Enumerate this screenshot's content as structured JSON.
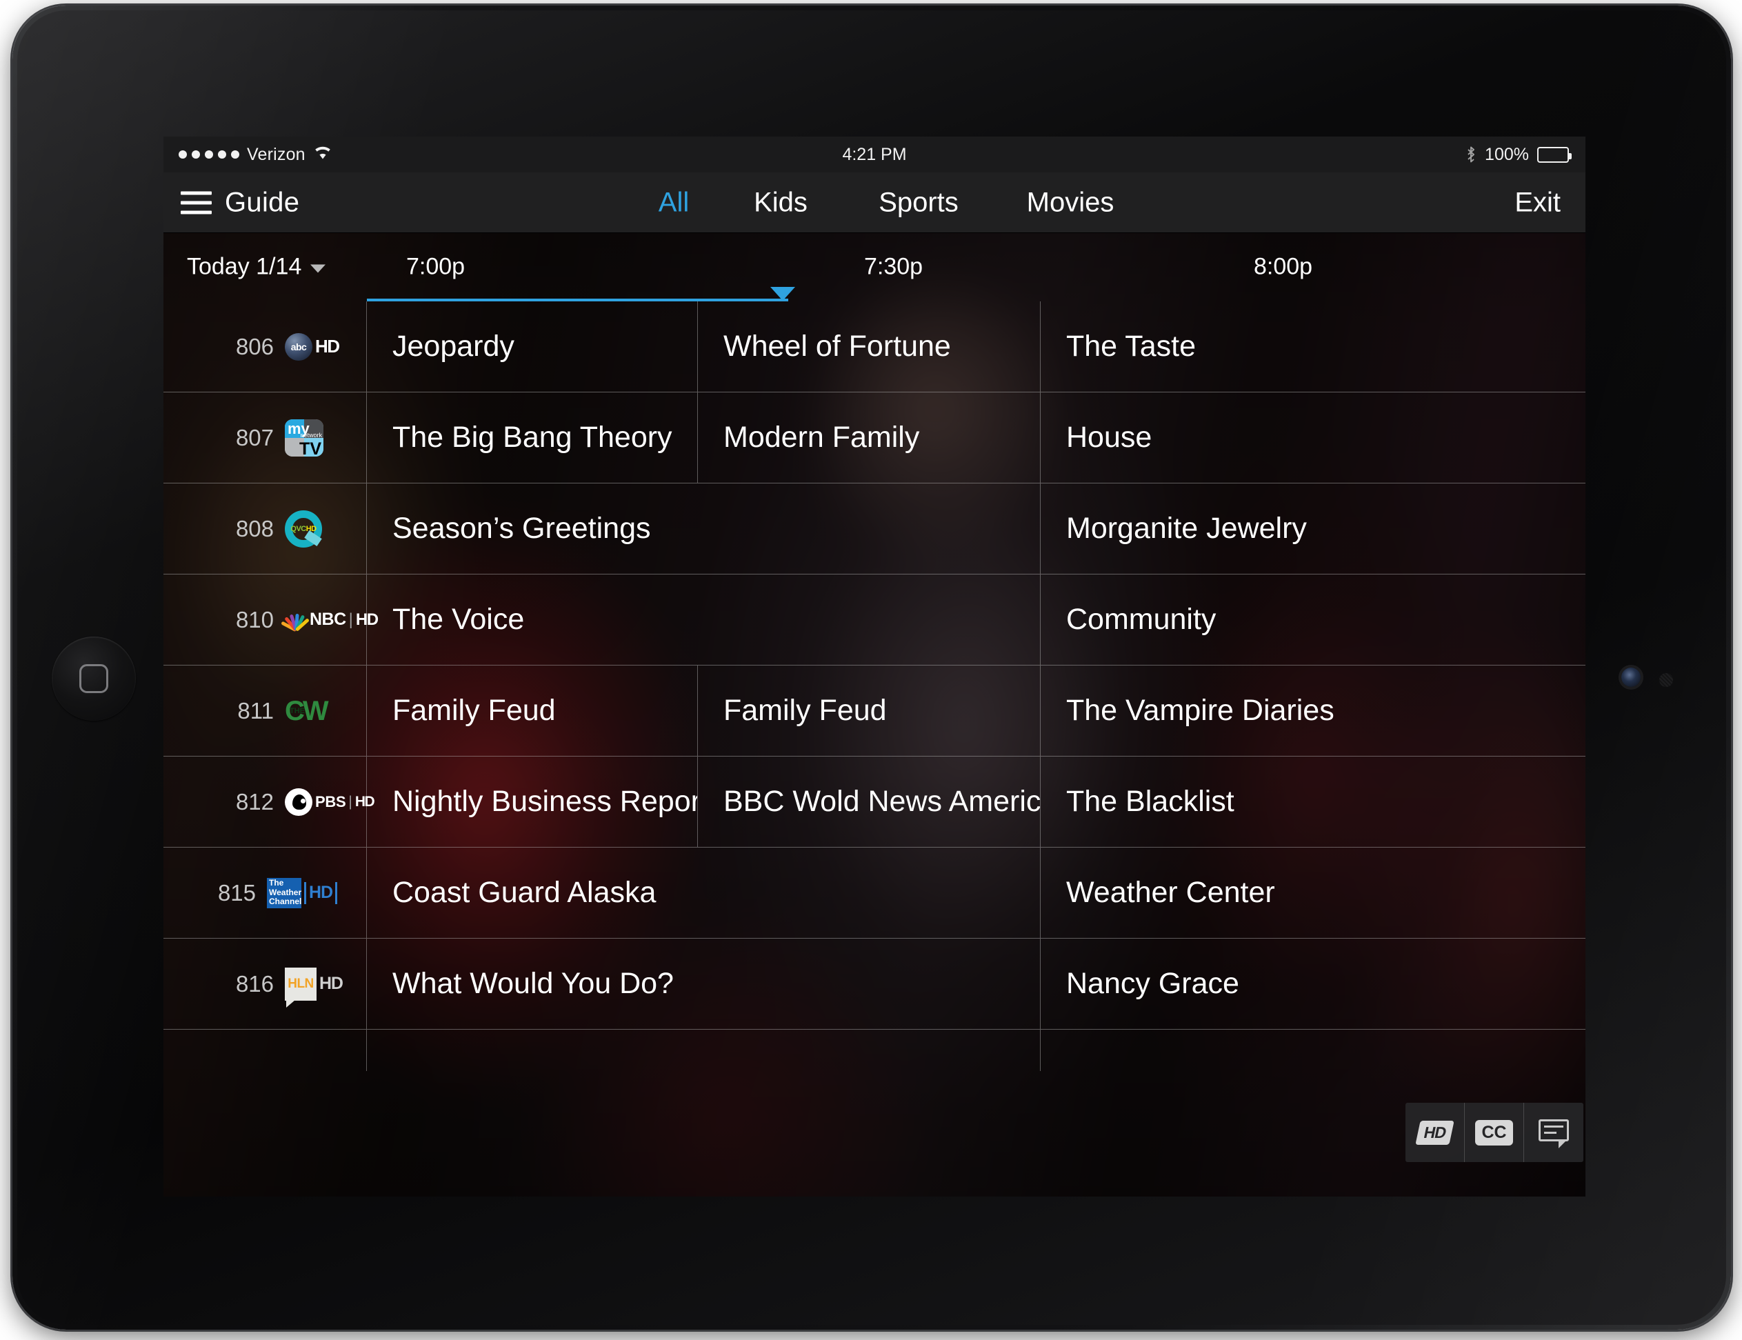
{
  "status_bar": {
    "carrier": "Verizon",
    "signal_dots": 5,
    "wifi_icon": "wifi-icon",
    "time": "4:21 PM",
    "bluetooth_icon": "bluetooth-icon",
    "battery_percent": "100%",
    "battery_icon": "battery-full-icon"
  },
  "nav": {
    "menu_icon": "hamburger-menu-icon",
    "guide_label": "Guide",
    "tabs": [
      {
        "label": "All",
        "active": true
      },
      {
        "label": "Kids",
        "active": false
      },
      {
        "label": "Sports",
        "active": false
      },
      {
        "label": "Movies",
        "active": false
      }
    ],
    "exit_label": "Exit",
    "accent_color": "#2fa2e0"
  },
  "timeline": {
    "date_label": "Today 1/14",
    "date_caret_icon": "chevron-down-icon",
    "slots": [
      "7:00p",
      "7:30p",
      "8:00p"
    ],
    "playhead_color": "#2fa2e0"
  },
  "grid": {
    "rows": [
      {
        "channel_number": "806",
        "logo": "abc-hd-logo",
        "programs": [
          {
            "title": "Jeopardy",
            "span": 1
          },
          {
            "title": "Wheel of Fortune",
            "span": 1
          },
          {
            "title": "The Taste",
            "span": 1
          }
        ]
      },
      {
        "channel_number": "807",
        "logo": "mynetworktv-logo",
        "programs": [
          {
            "title": "The Big Bang Theory",
            "span": 1
          },
          {
            "title": "Modern Family",
            "span": 1
          },
          {
            "title": "House",
            "span": 1
          }
        ]
      },
      {
        "channel_number": "808",
        "logo": "qvc-hd-logo",
        "programs": [
          {
            "title": "Season’s Greetings",
            "span": 2
          },
          {
            "title": "Morganite Jewelry",
            "span": 1
          }
        ]
      },
      {
        "channel_number": "810",
        "logo": "nbc-hd-logo",
        "programs": [
          {
            "title": "The Voice",
            "span": 2
          },
          {
            "title": "Community",
            "span": 1
          }
        ]
      },
      {
        "channel_number": "811",
        "logo": "the-cw-logo",
        "programs": [
          {
            "title": "Family Feud",
            "span": 1
          },
          {
            "title": "Family Feud",
            "span": 1
          },
          {
            "title": "The Vampire Diaries",
            "span": 1
          }
        ]
      },
      {
        "channel_number": "812",
        "logo": "pbs-hd-logo",
        "programs": [
          {
            "title": "Nightly Business Report",
            "span": 1
          },
          {
            "title": "BBC Wold News America",
            "span": 1
          },
          {
            "title": "The Blacklist",
            "span": 1
          }
        ]
      },
      {
        "channel_number": "815",
        "logo": "weather-channel-hd-logo",
        "programs": [
          {
            "title": "Coast Guard Alaska",
            "span": 2
          },
          {
            "title": "Weather Center",
            "span": 1
          }
        ]
      },
      {
        "channel_number": "816",
        "logo": "hln-hd-logo",
        "programs": [
          {
            "title": "What Would You Do?",
            "span": 2
          },
          {
            "title": "Nancy Grace",
            "span": 1
          }
        ]
      }
    ]
  },
  "controls": [
    {
      "name": "hd-toggle",
      "label": "HD"
    },
    {
      "name": "cc-toggle",
      "label": "CC"
    },
    {
      "name": "caption-bubble",
      "label": ""
    }
  ]
}
